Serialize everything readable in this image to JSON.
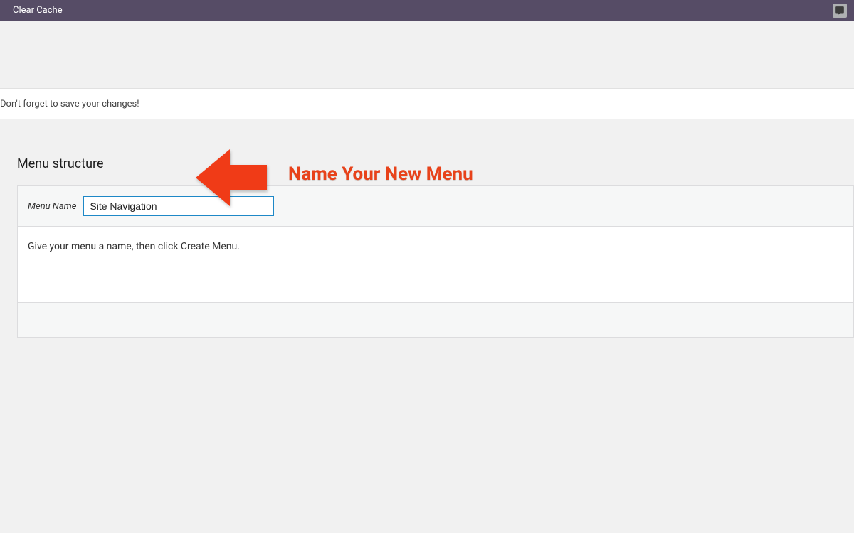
{
  "adminbar": {
    "clear_cache": "Clear Cache"
  },
  "notice": {
    "save_changes": "Don't forget to save your changes!"
  },
  "menu": {
    "structure_heading": "Menu structure",
    "name_label": "Menu Name",
    "name_value": "Site Navigation",
    "instruction": "Give your menu a name, then click Create Menu."
  },
  "annotation": {
    "text": "Name Your New Menu",
    "color": "#e8421a"
  }
}
